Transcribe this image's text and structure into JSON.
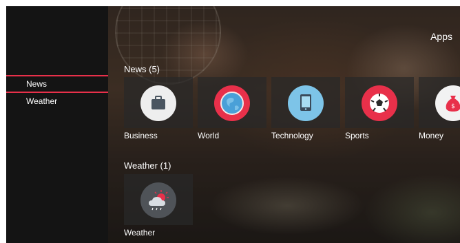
{
  "header": {
    "title": "Apps"
  },
  "sidebar": {
    "items": [
      {
        "label": "News",
        "selected": true
      },
      {
        "label": "Weather",
        "selected": false
      }
    ]
  },
  "rows": [
    {
      "title": "News (5)",
      "cards": [
        {
          "label": "Business",
          "icon": "briefcase-icon",
          "color": "#eeeeee"
        },
        {
          "label": "World",
          "icon": "globe-icon",
          "color": "#e8304a"
        },
        {
          "label": "Technology",
          "icon": "tablet-icon",
          "color": "#7dc4e8"
        },
        {
          "label": "Sports",
          "icon": "soccer-ball-icon",
          "color": "#e8304a"
        },
        {
          "label": "Money",
          "icon": "money-bag-icon",
          "color": "#f2f2f2"
        }
      ]
    },
    {
      "title": "Weather (1)",
      "cards": [
        {
          "label": "Weather",
          "icon": "cloud-sun-icon",
          "color": "#4f5358"
        }
      ]
    }
  ],
  "colors": {
    "accent": "#e8304a",
    "sidebar_bg": "#141414"
  }
}
